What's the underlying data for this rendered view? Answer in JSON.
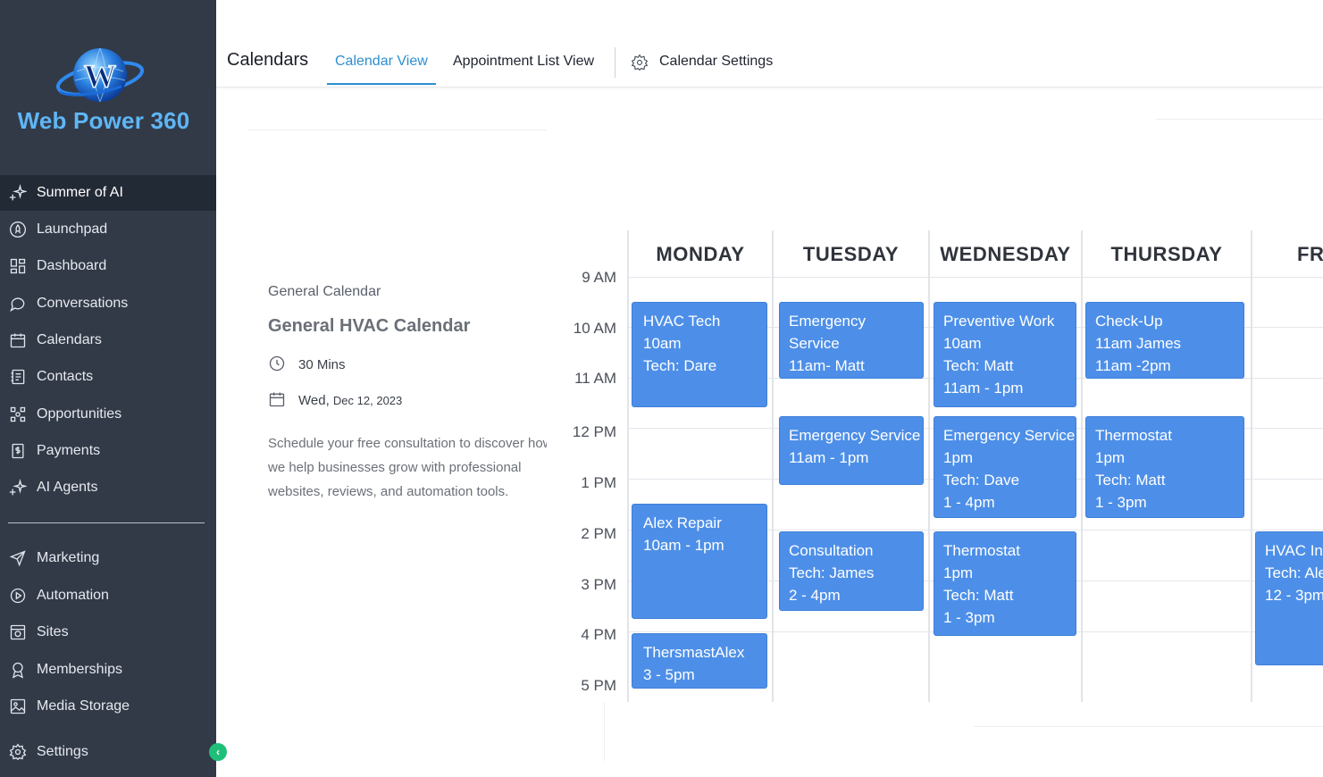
{
  "brand": {
    "name": "Web Power 360",
    "logo_letter": "W"
  },
  "sidebar": {
    "items": [
      {
        "label": "Summer of AI",
        "icon": "sparkle-icon",
        "active": true
      },
      {
        "label": "Launchpad",
        "icon": "rocket-icon"
      },
      {
        "label": "Dashboard",
        "icon": "dashboard-icon"
      },
      {
        "label": "Conversations",
        "icon": "chat-bubble-icon"
      },
      {
        "label": "Calendars",
        "icon": "calendar-icon"
      },
      {
        "label": "Contacts",
        "icon": "contacts-icon"
      },
      {
        "label": "Opportunities",
        "icon": "opportunities-icon"
      },
      {
        "label": "Payments",
        "icon": "payments-icon"
      },
      {
        "label": "AI Agents",
        "icon": "ai-agents-icon"
      }
    ],
    "secondary_items": [
      {
        "label": "Marketing",
        "icon": "send-icon"
      },
      {
        "label": "Automation",
        "icon": "automation-icon"
      },
      {
        "label": "Sites",
        "icon": "sites-icon"
      },
      {
        "label": "Memberships",
        "icon": "memberships-icon"
      },
      {
        "label": "Media Storage",
        "icon": "image-icon"
      }
    ],
    "settings_label": "Settings",
    "collapse_icon": "chevron-left-icon"
  },
  "header": {
    "title": "Calendars",
    "tabs": [
      {
        "label": "Calendar View",
        "active": true
      },
      {
        "label": "Appointment List View",
        "active": false
      }
    ],
    "settings_label": "Calendar Settings"
  },
  "info": {
    "calendar_name": "General Calendar",
    "calendar_title": "General HVAC Calendar",
    "duration": "30 Mins",
    "date_day": "Wed,",
    "date_rest": "Dec 12, 2023",
    "description_lines": [
      "Schedule your free consultation to discover how",
      "we help businesses grow with professional",
      "websites, reviews, and automation tools."
    ]
  },
  "calendar": {
    "times": [
      "9 AM",
      "10 AM",
      "11 AM",
      "12 PM",
      "1 PM",
      "2 PM",
      "3 PM",
      "4 PM",
      "5 PM"
    ],
    "days": [
      "MONDAY",
      "TUESDAY",
      "WEDNESDAY",
      "THURSDAY",
      "FRIDAY"
    ],
    "events": [
      {
        "day": 0,
        "lines": [
          "HVAC Tech",
          "10am",
          "Tech: Dare"
        ]
      },
      {
        "day": 0,
        "lines": [
          "Alex Repair",
          "10am - 1pm"
        ]
      },
      {
        "day": 0,
        "lines": [
          "ThersmastAlex",
          "3 - 5pm"
        ]
      },
      {
        "day": 1,
        "lines": [
          "Emergency",
          "Service",
          "11am- Matt"
        ]
      },
      {
        "day": 1,
        "lines": [
          "Emergency Service",
          "11am - 1pm"
        ]
      },
      {
        "day": 1,
        "lines": [
          "Consultation",
          "Tech: James",
          "2 - 4pm"
        ]
      },
      {
        "day": 2,
        "lines": [
          "Preventive Work",
          "10am",
          "Tech: Matt",
          "11am - 1pm"
        ]
      },
      {
        "day": 2,
        "lines": [
          "Emergency Service",
          "1pm",
          "Tech: Dave",
          "1 - 4pm"
        ]
      },
      {
        "day": 2,
        "lines": [
          "Thermostat",
          "1pm",
          "Tech: Matt",
          "1 - 3pm"
        ]
      },
      {
        "day": 3,
        "lines": [
          "Check-Up",
          "11am James",
          "11am -2pm"
        ]
      },
      {
        "day": 3,
        "lines": [
          "Thermostat",
          "1pm",
          "Tech: Matt",
          "1 - 3pm"
        ]
      },
      {
        "day": 4,
        "lines": [
          "HVAC Install",
          "Tech: Alex",
          "12 - 3pm"
        ]
      }
    ]
  },
  "colors": {
    "sidebar_bg": "#323a48",
    "sidebar_active_bg": "#222a36",
    "accent": "#2d8fd0",
    "event_bg": "#4d8fe8",
    "collapse_button": "#1fbf7a"
  }
}
